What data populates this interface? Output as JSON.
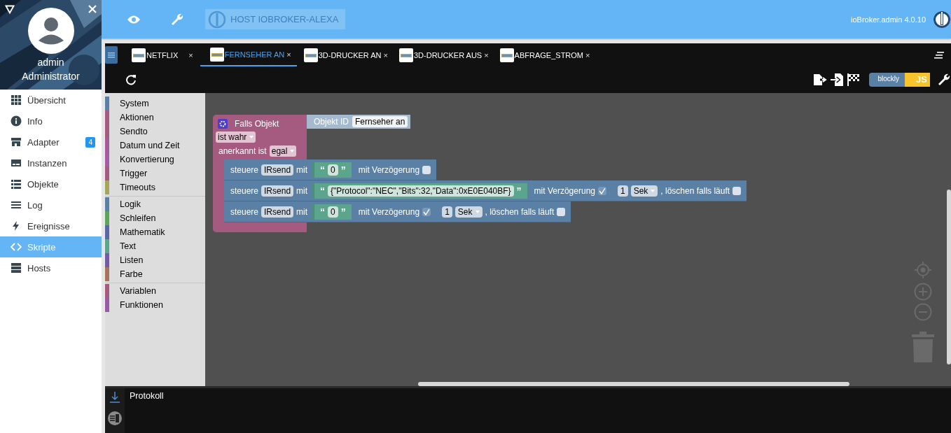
{
  "sidebar": {
    "user": {
      "name": "admin",
      "role": "Administrator"
    },
    "items": [
      {
        "label": "Übersicht",
        "selected": false
      },
      {
        "label": "Info",
        "selected": false
      },
      {
        "label": "Adapter",
        "selected": false,
        "badge": "4"
      },
      {
        "label": "Instanzen",
        "selected": false
      },
      {
        "label": "Objekte",
        "selected": false
      },
      {
        "label": "Log",
        "selected": false
      },
      {
        "label": "Ereignisse",
        "selected": false
      },
      {
        "label": "Skripte",
        "selected": true
      },
      {
        "label": "Hosts",
        "selected": false
      }
    ]
  },
  "header": {
    "host": "HOST IOBROKER-ALEXA",
    "version": "ioBroker.admin 4.0.10"
  },
  "tabs": [
    {
      "label": "NETFLIX",
      "selected": false,
      "close": "×"
    },
    {
      "label": "FERNSEHER AN",
      "selected": true,
      "close": "×"
    },
    {
      "label": "3D-DRUCKER AN",
      "selected": false,
      "close": "×"
    },
    {
      "label": "3D-DRUCKER AUS",
      "selected": false,
      "close": "×"
    },
    {
      "label": "ABFRAGE_STROM",
      "selected": false,
      "close": "×"
    }
  ],
  "toolbar": {
    "mode_toggle": {
      "left": "blockly",
      "right": "JS"
    }
  },
  "toolbox": {
    "groups": [
      [
        {
          "label": "System",
          "color": "#5b80a5"
        },
        {
          "label": "Aktionen",
          "color": "#a55b80"
        },
        {
          "label": "Sendto",
          "color": "#a55b80"
        },
        {
          "label": "Datum und Zeit",
          "color": "#a55b9a"
        },
        {
          "label": "Konvertierung",
          "color": "#a55ba5"
        },
        {
          "label": "Trigger",
          "color": "#a55b80"
        },
        {
          "label": "Timeouts",
          "color": "#a5a55b"
        }
      ],
      [
        {
          "label": "Logik",
          "color": "#5b80a5"
        },
        {
          "label": "Schleifen",
          "color": "#5ba55b"
        },
        {
          "label": "Mathematik",
          "color": "#5b67a5"
        },
        {
          "label": "Text",
          "color": "#5ba58c"
        },
        {
          "label": "Listen",
          "color": "#745ba5"
        },
        {
          "label": "Farbe",
          "color": "#a5745b"
        }
      ],
      [
        {
          "label": "Variablen",
          "color": "#a55b80"
        },
        {
          "label": "Funktionen",
          "color": "#995ba5"
        }
      ]
    ]
  },
  "workspace": {
    "trigger": {
      "title": "Falls Objekt",
      "object_label": "Objekt ID",
      "object_value": "Fernseher an",
      "condition": "ist wahr",
      "ack_label": "anerkannt ist",
      "ack_value": "egal",
      "statements": [
        {
          "verb": "steuere",
          "device": "IRsend",
          "with": "mit",
          "quote_open": "“",
          "value": "0",
          "quote_close": "”",
          "delay_label": "mit Verzögerung",
          "delay": false
        },
        {
          "verb": "steuere",
          "device": "IRsend",
          "with": "mit",
          "quote_open": "“",
          "value": "{\"Protocol\":\"NEC\",\"Bits\":32,\"Data\":0xE0E040BF}",
          "quote_close": "”",
          "delay_label": "mit Verzögerung",
          "delay": true,
          "amount": "1",
          "unit": "Sek",
          "clear_label": ", löschen falls läuft",
          "clear": false
        },
        {
          "verb": "steuere",
          "device": "IRsend",
          "with": "mit",
          "quote_open": "“",
          "value": "0",
          "quote_close": "”",
          "delay_label": "mit Verzögerung",
          "delay": true,
          "amount": "1",
          "unit": "Sek",
          "clear_label": ", löschen falls läuft",
          "clear": false
        }
      ]
    }
  },
  "log": {
    "title": "Protokoll"
  }
}
